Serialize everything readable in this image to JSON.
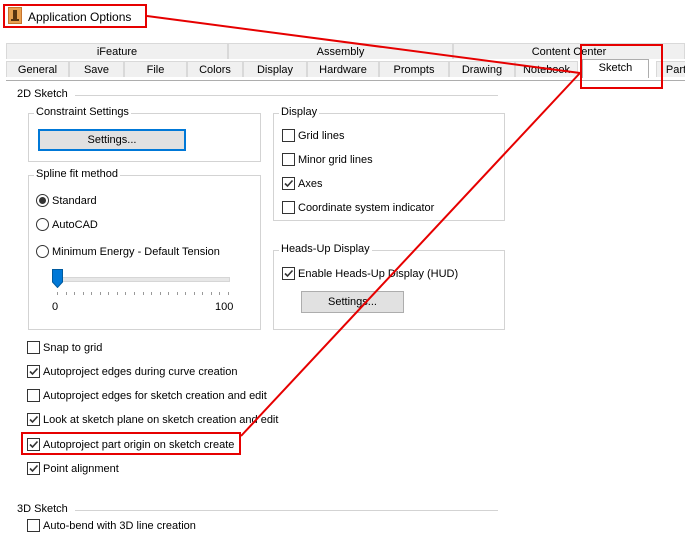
{
  "window": {
    "title": "Application Options"
  },
  "tabs": {
    "row1": [
      "iFeature",
      "Assembly",
      "Content Center"
    ],
    "row2": [
      "General",
      "Save",
      "File",
      "Colors",
      "Display",
      "Hardware",
      "Prompts",
      "Drawing",
      "Notebook",
      "Sketch",
      "Part"
    ]
  },
  "sketch2d": {
    "section_title": "2D Sketch",
    "constraint": {
      "group_label": "Constraint Settings",
      "button": "Settings..."
    },
    "spline": {
      "group_label": "Spline fit method",
      "options": [
        {
          "label": "Standard",
          "selected": true
        },
        {
          "label": "AutoCAD",
          "selected": false
        },
        {
          "label": "Minimum Energy - Default Tension",
          "selected": false
        }
      ],
      "slider_min": "0",
      "slider_max": "100",
      "slider_value": 0
    },
    "display": {
      "group_label": "Display",
      "options": [
        {
          "label": "Grid lines",
          "checked": false
        },
        {
          "label": "Minor grid lines",
          "checked": false
        },
        {
          "label": "Axes",
          "checked": true
        },
        {
          "label": "Coordinate system indicator",
          "checked": false
        }
      ]
    },
    "hud": {
      "group_label": "Heads-Up Display",
      "enable_label": "Enable Heads-Up Display (HUD)",
      "enable_checked": true,
      "button": "Settings..."
    },
    "options": [
      {
        "label": "Snap to grid",
        "checked": false
      },
      {
        "label": "Autoproject edges during curve creation",
        "checked": true
      },
      {
        "label": "Autoproject edges for sketch creation and edit",
        "checked": false
      },
      {
        "label": "Look at sketch plane on sketch creation and edit",
        "checked": true
      },
      {
        "label": "Autoproject part origin on sketch create",
        "checked": true
      },
      {
        "label": "Point alignment",
        "checked": true
      }
    ]
  },
  "sketch3d": {
    "section_title": "3D Sketch",
    "options": [
      {
        "label": "Auto-bend with 3D line creation",
        "checked": false
      }
    ]
  },
  "colors": {
    "highlight": "#e60000",
    "focus": "#0078d7"
  }
}
